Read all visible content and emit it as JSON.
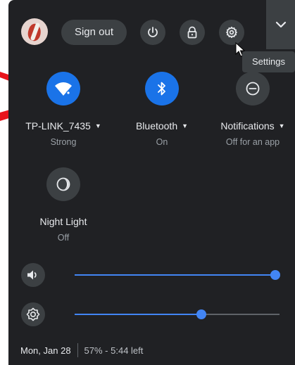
{
  "header": {
    "signout_label": "Sign out",
    "buttons": [
      {
        "name": "power",
        "icon": "power-icon"
      },
      {
        "name": "lock",
        "icon": "lock-icon"
      },
      {
        "name": "settings",
        "icon": "gear-icon"
      }
    ],
    "collapse_icon": "chevron-down-icon",
    "tooltip": "Settings"
  },
  "pods": [
    {
      "label": "TP-LINK_7435",
      "sub": "Strong",
      "icon": "wifi-icon",
      "active": true
    },
    {
      "label": "Bluetooth",
      "sub": "On",
      "icon": "bluetooth-icon",
      "active": true
    },
    {
      "label": "Notifications",
      "sub": "Off for an app",
      "icon": "do-not-disturb-icon",
      "active": false
    },
    {
      "label": "Night Light",
      "sub": "Off",
      "icon": "night-light-icon",
      "active": false
    }
  ],
  "sliders": {
    "volume": {
      "icon": "volume-icon",
      "value": 1.0
    },
    "brightness": {
      "icon": "brightness-icon",
      "value": 0.62
    }
  },
  "footer": {
    "date": "Mon, Jan 28",
    "battery": "57% - 5:44 left"
  },
  "colors": {
    "panel": "#202124",
    "active": "#1a73e8",
    "slider": "#4285f4",
    "annotation_arrow": "#e8141b"
  }
}
